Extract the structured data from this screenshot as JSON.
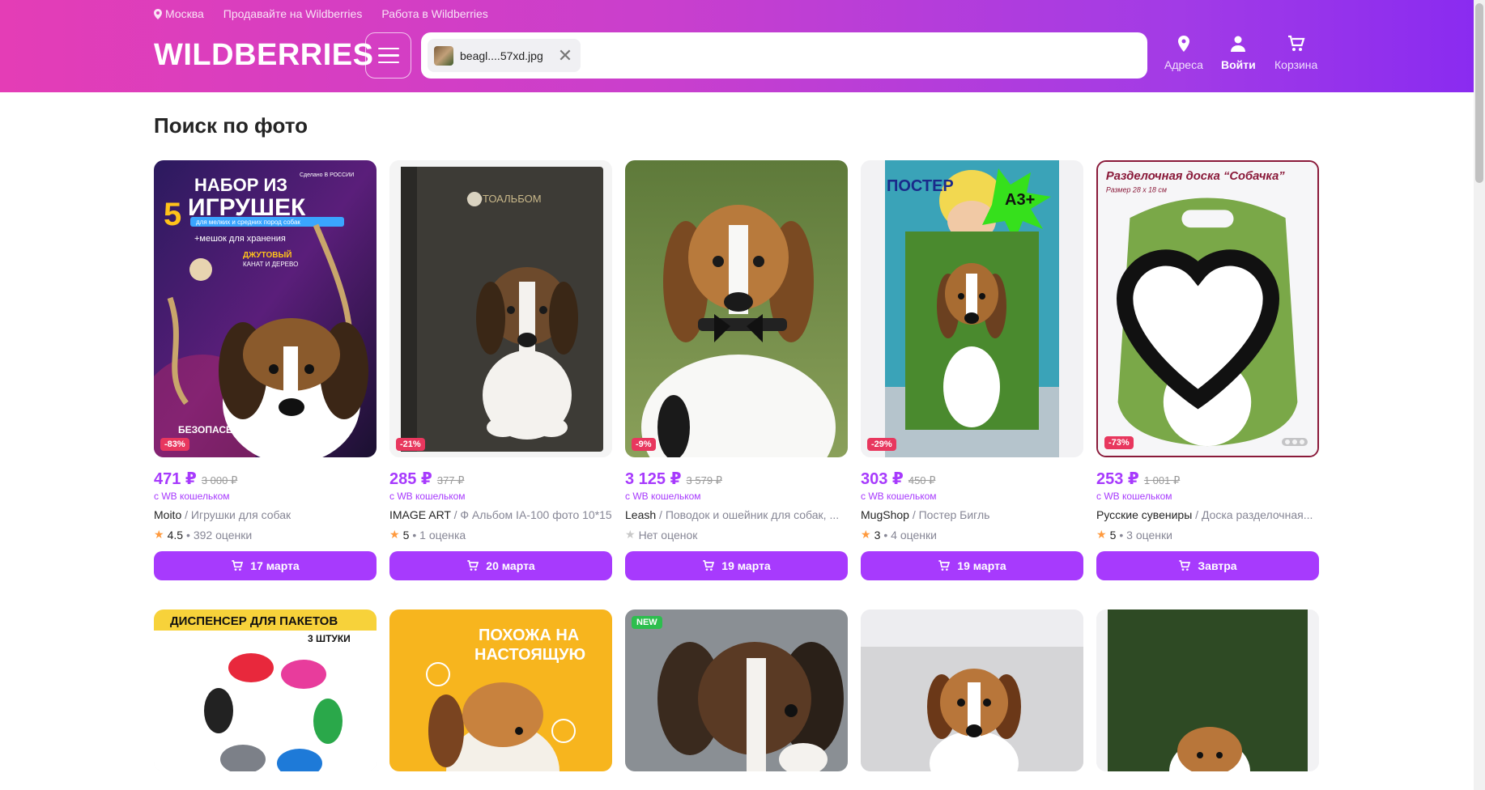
{
  "topbar": {
    "city": "Москва",
    "sell": "Продавайте на Wildberries",
    "work": "Работа в Wildberries"
  },
  "logo": "WILDBERRIES",
  "search": {
    "chip_label": "beagl....57xd.jpg"
  },
  "nav": {
    "addresses": "Адреса",
    "login": "Войти",
    "cart": "Корзина"
  },
  "page_title": "Поиск по фото",
  "products": [
    {
      "price": "471 ₽",
      "old": "3 000 ₽",
      "wallet": "с WB кошельком",
      "brand": "Moito",
      "category": " / Игрушки для собак",
      "rating": "4.5",
      "reviews": " • 392 оценки",
      "discount": "-83%",
      "delivery": "17 марта"
    },
    {
      "price": "285 ₽",
      "old": "377 ₽",
      "wallet": "с WB кошельком",
      "brand": "IMAGE ART",
      "category": " / Ф Альбом IA-100 фото 10*15",
      "rating": "5",
      "reviews": " • 1 оценка",
      "discount": "-21%",
      "delivery": "20 марта"
    },
    {
      "price": "3 125 ₽",
      "old": "3 579 ₽",
      "wallet": "с WB кошельком",
      "brand": "Leash",
      "category": " / Поводок и ошейник для собак, ...",
      "rating": "",
      "reviews": "Нет оценок",
      "discount": "-9%",
      "delivery": "19 марта"
    },
    {
      "price": "303 ₽",
      "old": "450 ₽",
      "wallet": "с WB кошельком",
      "brand": "MugShop",
      "category": " / Постер Бигль",
      "rating": "3",
      "reviews": " • 4 оценки",
      "discount": "-29%",
      "delivery": "19 марта"
    },
    {
      "price": "253 ₽",
      "old": "1 001 ₽",
      "wallet": "с WB кошельком",
      "brand": "Русские сувениры",
      "category": " / Доска разделочная...",
      "rating": "5",
      "reviews": " • 3 оценки",
      "discount": "-73%",
      "delivery": "Завтра"
    }
  ],
  "img_text": {
    "p1_line1": "НАБОР ИЗ",
    "p1_num": "5",
    "p1_line2": "ИГРУШЕК",
    "p1_sub": "для мелких и средних пород собак",
    "p1_bag": "+мешок для хранения",
    "p1_jute": "ДЖУТОВЫЙ",
    "p1_rope": "КАНАТ И ДЕРЕВО",
    "p1_safe": "БЕЗОПАСЕН",
    "p1_made": "Сделано В РОССИИ",
    "p2_brand": "ФОТОАЛЬБОМ",
    "p4_poster": "ПОСТЕР",
    "p4_size": "А3+",
    "p5_title": "Разделочная доска “Собачка”",
    "p5_size": "Размер 28 х 18 см",
    "r1_title": "ДИСПЕНСЕР ДЛЯ ПАКЕТОВ",
    "r1_count": "3 ШТУКИ",
    "r2_title1": "ПОХОЖА НА",
    "r2_title2": "НАСТОЯЩУЮ",
    "r3_badge": "NEW"
  }
}
